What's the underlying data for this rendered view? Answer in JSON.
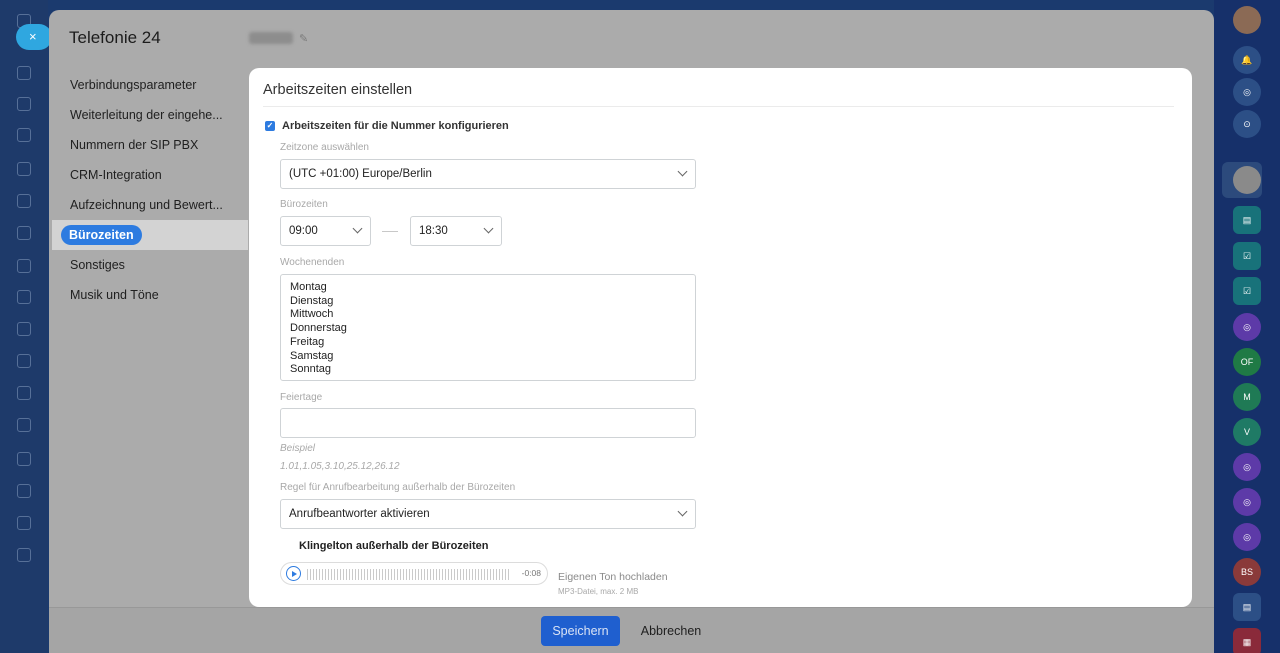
{
  "app": {
    "panel_title": "Telefonie 24",
    "close_icon": "×"
  },
  "nav": {
    "items": [
      {
        "label": "Verbindungsparameter",
        "active": false
      },
      {
        "label": "Weiterleitung der eingehe...",
        "active": false
      },
      {
        "label": "Nummern der SIP PBX",
        "active": false
      },
      {
        "label": "CRM-Integration",
        "active": false
      },
      {
        "label": "Aufzeichnung und Bewert...",
        "active": false
      },
      {
        "label": "Bürozeiten",
        "active": true
      },
      {
        "label": "Sonstiges",
        "active": false
      },
      {
        "label": "Musik und Töne",
        "active": false
      }
    ]
  },
  "modal": {
    "title": "Arbeitszeiten einstellen",
    "configure_checkbox": {
      "label": "Arbeitszeiten für die Nummer konfigurieren",
      "checked": true
    },
    "timezone": {
      "label": "Zeitzone auswählen",
      "value": "(UTC +01:00) Europe/Berlin"
    },
    "office_hours": {
      "label": "Bürozeiten",
      "from": "09:00",
      "to": "18:30"
    },
    "weekends": {
      "label": "Wochenenden",
      "options": [
        "Montag",
        "Dienstag",
        "Mittwoch",
        "Donnerstag",
        "Freitag",
        "Samstag",
        "Sonntag"
      ]
    },
    "holidays": {
      "label": "Feiertage",
      "value": "",
      "example_label": "Beispiel",
      "example_value": "1.01,1.05,3.10,25.12,26.12"
    },
    "rule": {
      "label": "Regel für Anrufbearbeitung außerhalb der Bürozeiten",
      "value": "Anrufbeantworter aktivieren"
    },
    "ringtone": {
      "title": "Klingelton außerhalb der Bürozeiten",
      "time": "-0:08",
      "upload_label": "Eigenen Ton hochladen",
      "upload_hint": "MP3-Datei, max. 2 MB"
    }
  },
  "footer": {
    "save_label": "Speichern",
    "cancel_label": "Abbrechen"
  },
  "right_rail": {
    "items": [
      "bell-icon",
      "target-icon",
      "search-chat-icon",
      "user-avatar",
      "contact-card-icon",
      "task-check-icon",
      "task-check-icon",
      "open-channel-icon",
      "OF",
      "M",
      "V",
      "open-channel-icon",
      "open-channel-icon",
      "open-channel-icon",
      "BS",
      "contact-card-icon",
      "calendar-icon"
    ]
  },
  "colors": {
    "accent": "#2d7be0",
    "save_button": "#1f5fcf",
    "panel_overlay": "#ababab",
    "right_rail": "#16306a"
  }
}
